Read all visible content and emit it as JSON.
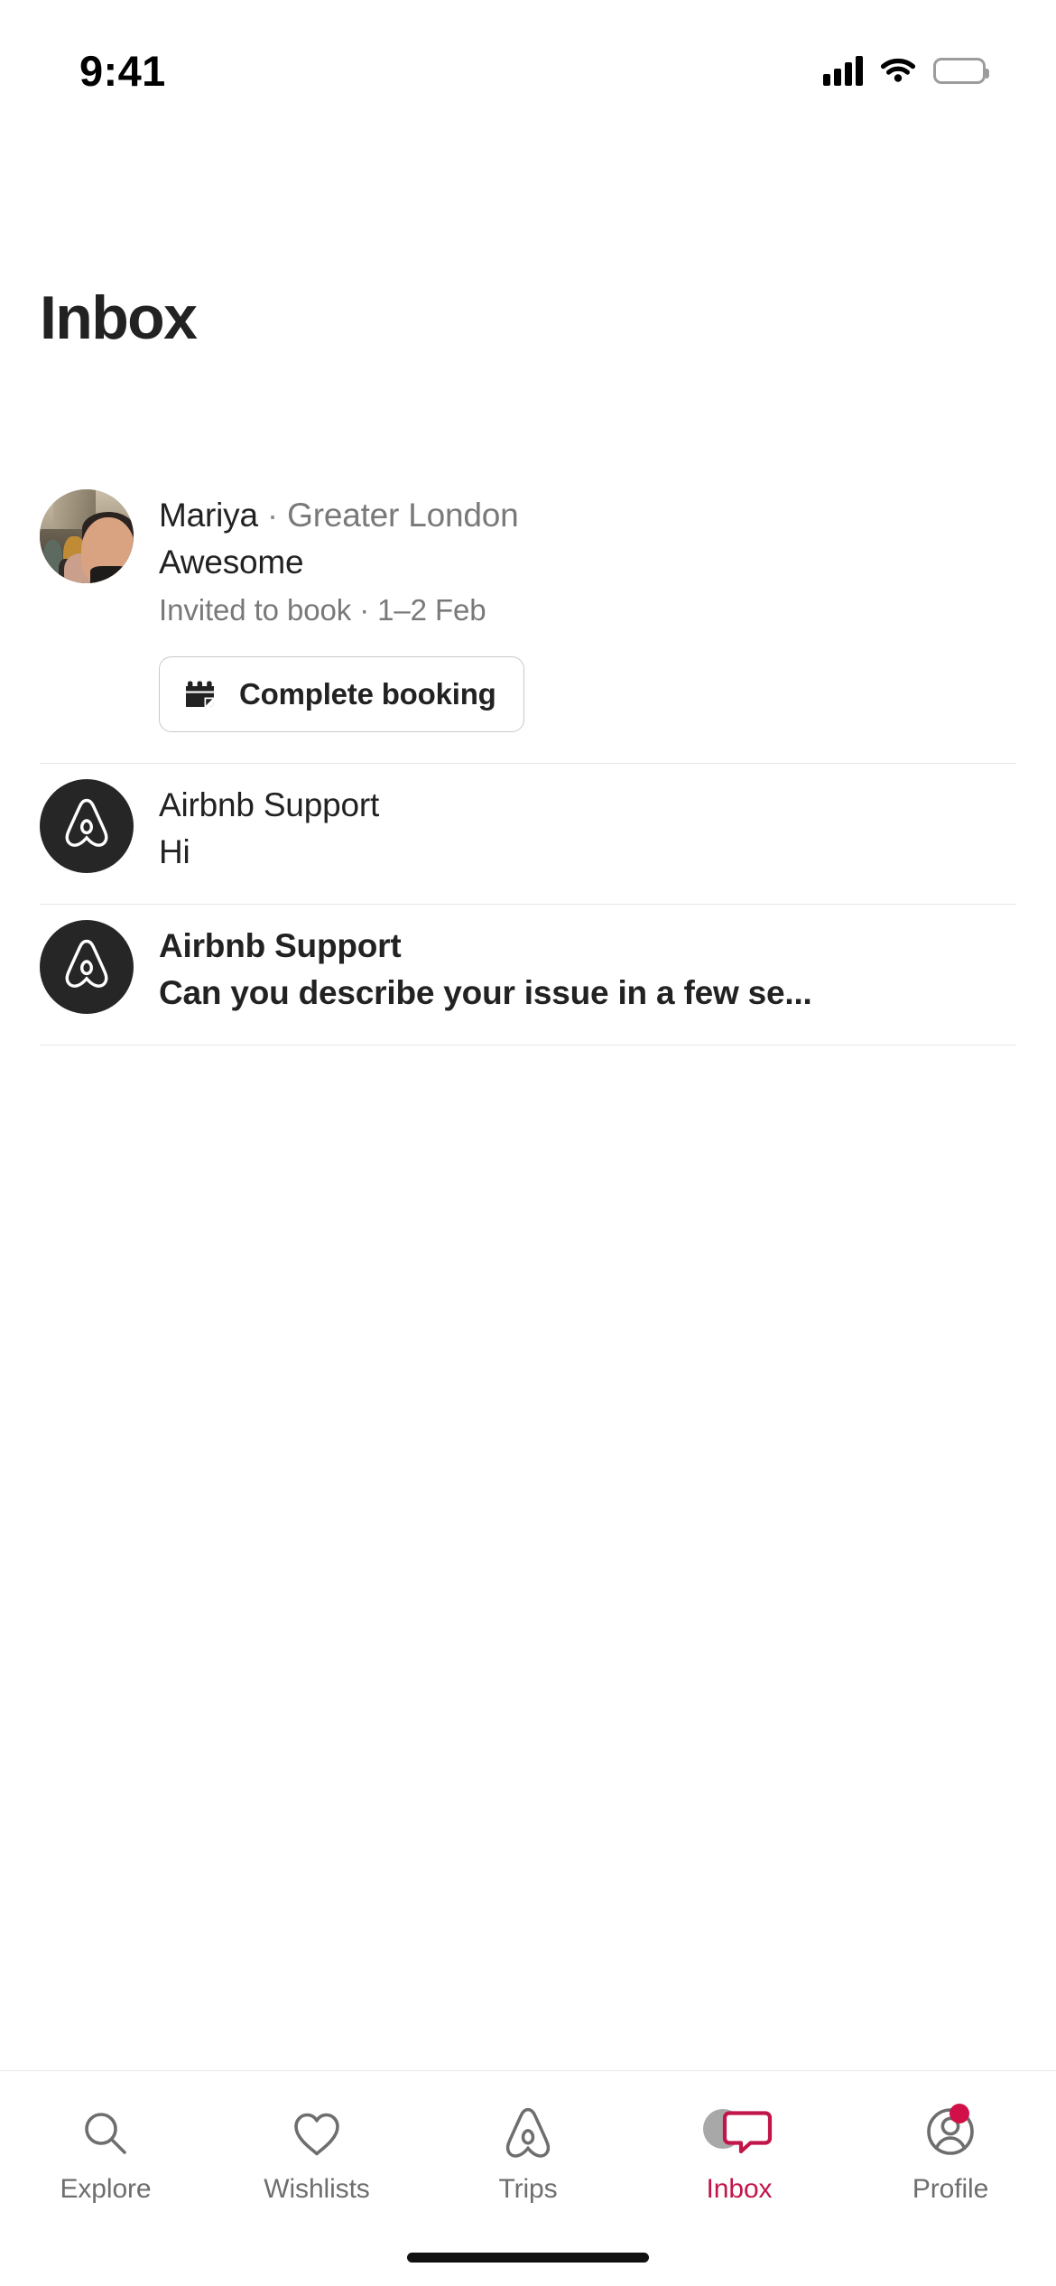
{
  "status_bar": {
    "time": "9:41",
    "signal_icon": "cellular-signal-icon",
    "wifi_icon": "wifi-icon",
    "battery_icon": "battery-full-icon"
  },
  "header": {
    "title": "Inbox"
  },
  "threads": [
    {
      "id": "mariya",
      "avatar_type": "photo",
      "avatar_name": "avatar-mariya-photo",
      "name": "Mariya",
      "separator": "·",
      "location": "Greater London",
      "preview": "Awesome",
      "meta": "Invited to book · 1–2 Feb",
      "unread": false,
      "cta": {
        "label": "Complete booking",
        "icon": "calendar-icon"
      }
    },
    {
      "id": "support-hi",
      "avatar_type": "belo",
      "avatar_name": "avatar-airbnb-support",
      "name": "Airbnb Support",
      "preview": "Hi",
      "unread": false
    },
    {
      "id": "support-issue",
      "avatar_type": "belo",
      "avatar_name": "avatar-airbnb-support",
      "name": "Airbnb Support",
      "preview": "Can you describe your issue in a few se...",
      "unread": true
    }
  ],
  "tab_bar": {
    "active": "Inbox",
    "accent_color": "#C1164A",
    "inactive_color": "#6E6E6E",
    "badge_color": "#D1104A",
    "items": [
      {
        "label": "Explore",
        "icon": "search-icon",
        "active": false,
        "badge": false
      },
      {
        "label": "Wishlists",
        "icon": "heart-icon",
        "active": false,
        "badge": false
      },
      {
        "label": "Trips",
        "icon": "airbnb-belo-icon",
        "active": false,
        "badge": false
      },
      {
        "label": "Inbox",
        "icon": "message-bubble-icon",
        "active": true,
        "badge": false
      },
      {
        "label": "Profile",
        "icon": "user-circle-icon",
        "active": false,
        "badge": true
      }
    ]
  }
}
